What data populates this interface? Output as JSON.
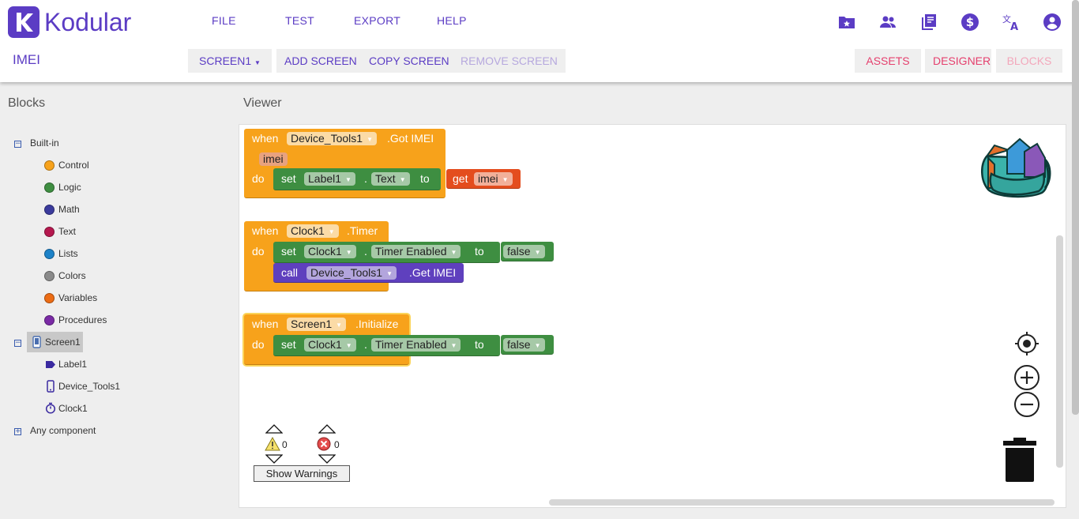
{
  "app": {
    "logo_text": "Kodular",
    "project_name": "IMEI"
  },
  "menu": {
    "file": "FILE",
    "test": "TEST",
    "export": "EXPORT",
    "help": "HELP"
  },
  "toolbar": {
    "screen_select": "SCREEN1",
    "add_screen": "ADD SCREEN",
    "copy_screen": "COPY SCREEN",
    "remove_screen": "REMOVE SCREEN",
    "assets": "ASSETS",
    "designer": "DESIGNER",
    "blocks": "BLOCKS"
  },
  "top_icons": [
    "folder-star-icon",
    "people-icon",
    "library-icon",
    "dollar-icon",
    "translate-icon",
    "account-icon"
  ],
  "blocks_panel": {
    "title": "Blocks",
    "builtin": "Built-in",
    "items": [
      {
        "label": "Control",
        "color": "#f7a21b"
      },
      {
        "label": "Logic",
        "color": "#3e8e41"
      },
      {
        "label": "Math",
        "color": "#3a3a9c"
      },
      {
        "label": "Text",
        "color": "#b5184e"
      },
      {
        "label": "Lists",
        "color": "#1d82c8"
      },
      {
        "label": "Colors",
        "color": "#8a8a8a"
      },
      {
        "label": "Variables",
        "color": "#ec6c14"
      },
      {
        "label": "Procedures",
        "color": "#7a2aa5"
      }
    ],
    "screen": "Screen1",
    "components": [
      "Label1",
      "Device_Tools1",
      "Clock1"
    ],
    "any_component": "Any component"
  },
  "viewer": {
    "title": "Viewer",
    "block1": {
      "when": "when",
      "component": "Device_Tools1",
      "event": ".Got IMEI",
      "param": "imei",
      "do": "do",
      "set": "set",
      "target": "Label1",
      "dot": ".",
      "prop": "Text",
      "to": "to",
      "get": "get",
      "var": "imei"
    },
    "block2": {
      "when": "when",
      "component": "Clock1",
      "event": ".Timer",
      "do": "do",
      "set": "set",
      "target": "Clock1",
      "dot": ".",
      "prop": "Timer Enabled",
      "to": "to",
      "value": "false",
      "call": "call",
      "call_component": "Device_Tools1",
      "method": ".Get IMEI"
    },
    "block3": {
      "when": "when",
      "component": "Screen1",
      "event": ".Initialize",
      "do": "do",
      "set": "set",
      "target": "Clock1",
      "dot": ".",
      "prop": "Timer Enabled",
      "to": "to",
      "value": "false"
    },
    "warnings": {
      "warning_count": "0",
      "error_count": "0",
      "show_warnings": "Show Warnings"
    }
  },
  "colors": {
    "brand": "#5b3cc4",
    "accent_pink": "#e53f6d"
  }
}
